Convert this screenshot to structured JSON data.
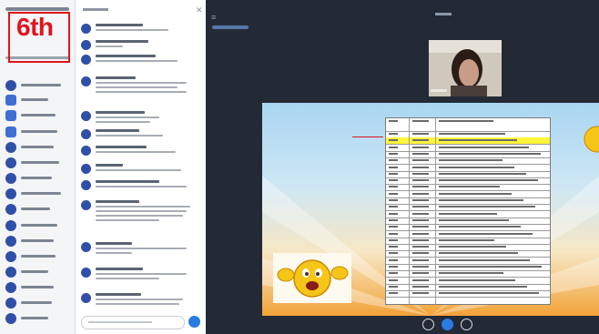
{
  "overlay": {
    "label": "6th",
    "color": "#e0141e"
  },
  "icons": {
    "menu": "hamburger-menu-icon",
    "close": "close-icon",
    "send": "send-icon",
    "microphone": "microphone-icon",
    "phone": "phone-icon",
    "camera": "camera-icon"
  },
  "colors": {
    "accent": "#2a7ae2",
    "presentation_bg": "#232a35",
    "highlight": "#fff53a"
  }
}
